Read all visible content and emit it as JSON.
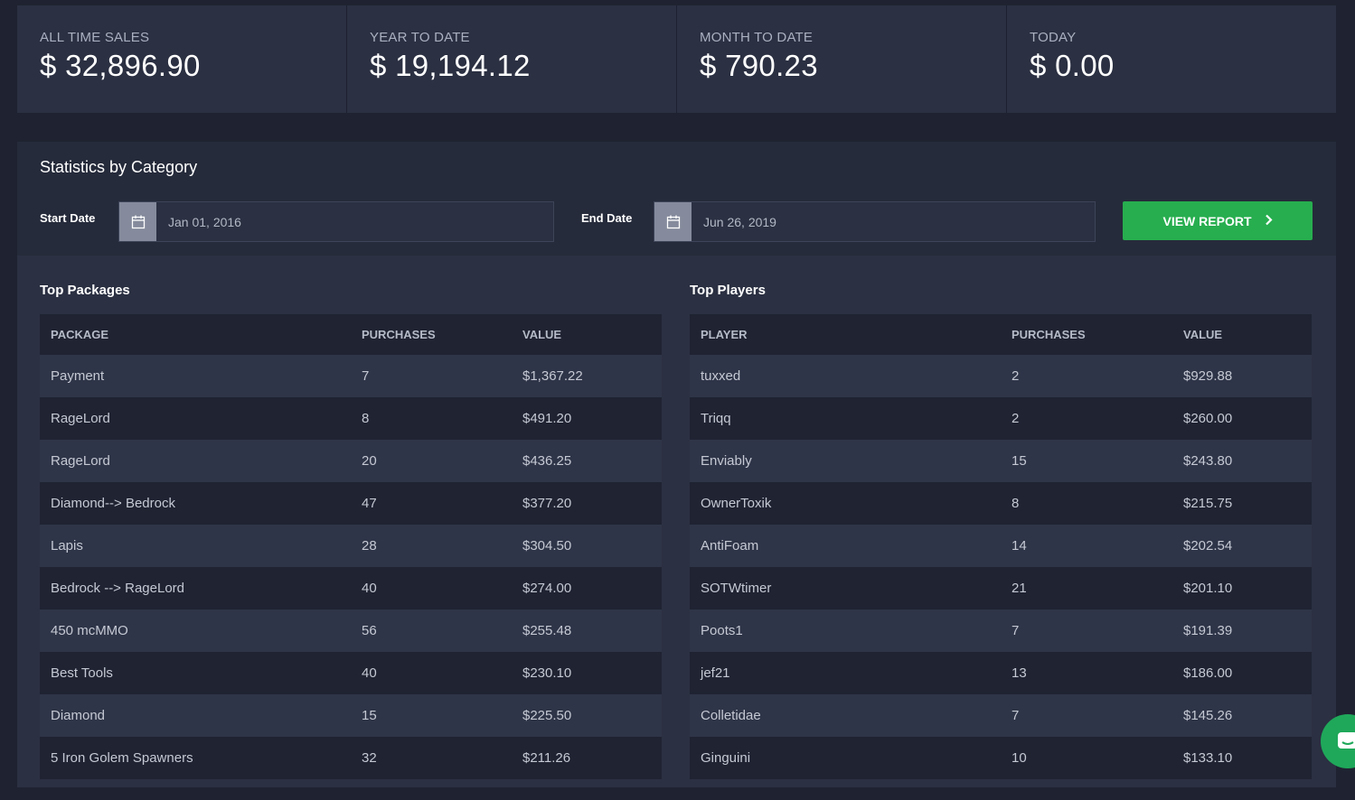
{
  "stats": [
    {
      "label": "ALL TIME SALES",
      "value": "$ 32,896.90"
    },
    {
      "label": "YEAR TO DATE",
      "value": "$ 19,194.12"
    },
    {
      "label": "MONTH TO DATE",
      "value": "$ 790.23"
    },
    {
      "label": "TODAY",
      "value": "$ 0.00"
    }
  ],
  "panel": {
    "title": "Statistics by Category",
    "start_label": "Start Date",
    "start_value": "Jan 01, 2016",
    "end_label": "End Date",
    "end_value": "Jun 26, 2019",
    "view_button": "VIEW REPORT"
  },
  "packages": {
    "title": "Top Packages",
    "headers": [
      "PACKAGE",
      "PURCHASES",
      "VALUE"
    ],
    "rows": [
      [
        "Payment",
        "7",
        "$1,367.22"
      ],
      [
        "RageLord",
        "8",
        "$491.20"
      ],
      [
        "RageLord",
        "20",
        "$436.25"
      ],
      [
        "Diamond--> Bedrock",
        "47",
        "$377.20"
      ],
      [
        "Lapis",
        "28",
        "$304.50"
      ],
      [
        "Bedrock --> RageLord",
        "40",
        "$274.00"
      ],
      [
        "450 mcMMO",
        "56",
        "$255.48"
      ],
      [
        "Best Tools",
        "40",
        "$230.10"
      ],
      [
        "Diamond",
        "15",
        "$225.50"
      ],
      [
        "5 Iron Golem Spawners",
        "32",
        "$211.26"
      ]
    ]
  },
  "players": {
    "title": "Top Players",
    "headers": [
      "PLAYER",
      "PURCHASES",
      "VALUE"
    ],
    "rows": [
      [
        "tuxxed",
        "2",
        "$929.88"
      ],
      [
        "Triqq",
        "2",
        "$260.00"
      ],
      [
        "Enviably",
        "15",
        "$243.80"
      ],
      [
        "OwnerToxik",
        "8",
        "$215.75"
      ],
      [
        "AntiFoam",
        "14",
        "$202.54"
      ],
      [
        "SOTWtimer",
        "21",
        "$201.10"
      ],
      [
        "Poots1",
        "7",
        "$191.39"
      ],
      [
        "jef21",
        "13",
        "$186.00"
      ],
      [
        "Colletidae",
        "7",
        "$145.26"
      ],
      [
        "Ginguini",
        "10",
        "$133.10"
      ]
    ]
  },
  "colors": {
    "background": "#1f2331",
    "card": "#2b3042",
    "accent_green": "#27ae4f"
  },
  "icons": {
    "calendar": "calendar-icon",
    "chevron": "chevron-right-icon",
    "chat": "chat-icon"
  }
}
